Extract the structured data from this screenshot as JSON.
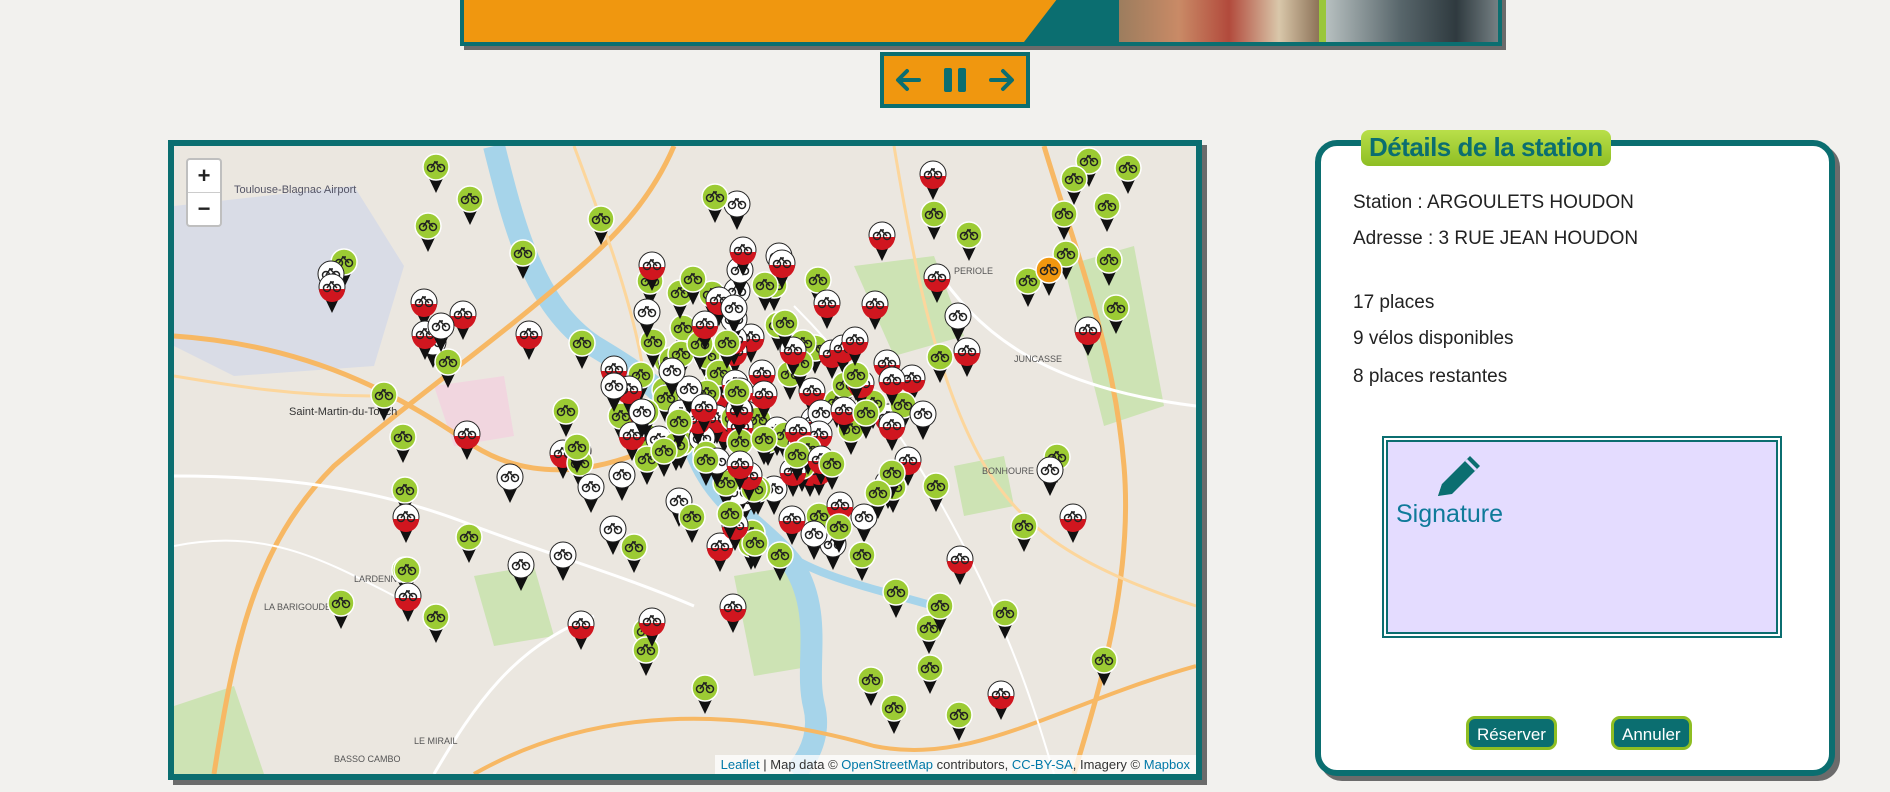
{
  "slider": {
    "controls": {
      "prev_icon": "arrow-left-icon",
      "pause_icon": "pause-icon",
      "next_icon": "arrow-right-icon"
    },
    "colors": {
      "banner": "#f0970f",
      "border": "#0b6e70"
    }
  },
  "map": {
    "zoom_in": "+",
    "zoom_out": "−",
    "attribution": {
      "leaflet": "Leaflet",
      "sep1": " | Map data © ",
      "osm": "OpenStreetMap",
      "sep2": " contributors, ",
      "license": "CC-BY-SA",
      "sep3": ", Imagery © ",
      "mapbox": "Mapbox"
    },
    "place_labels": [
      "Toulouse-Blagnac Airport",
      "Saint-Martin-du-Touch",
      "LARDENNE",
      "LA BARIGOUDE",
      "BONHOURE",
      "JUNCASSE",
      "PERIOLE",
      "LE MIRAIL",
      "BASSO CAMBO"
    ],
    "marker_colors": {
      "available": "#9ccb34",
      "empty": "#d0161f",
      "selected": "#f0970f"
    }
  },
  "details": {
    "legend": "Détails de la station",
    "station": "Station : ARGOULETS HOUDON",
    "address": "Adresse : 3 RUE JEAN HOUDON",
    "places": "17 places",
    "bikes": "9 vélos disponibles",
    "remaining": "8 places restantes",
    "signature_label": "Signature",
    "signature_icon": "pencil-icon",
    "reserve_button": "Réserver",
    "cancel_button": "Annuler"
  }
}
